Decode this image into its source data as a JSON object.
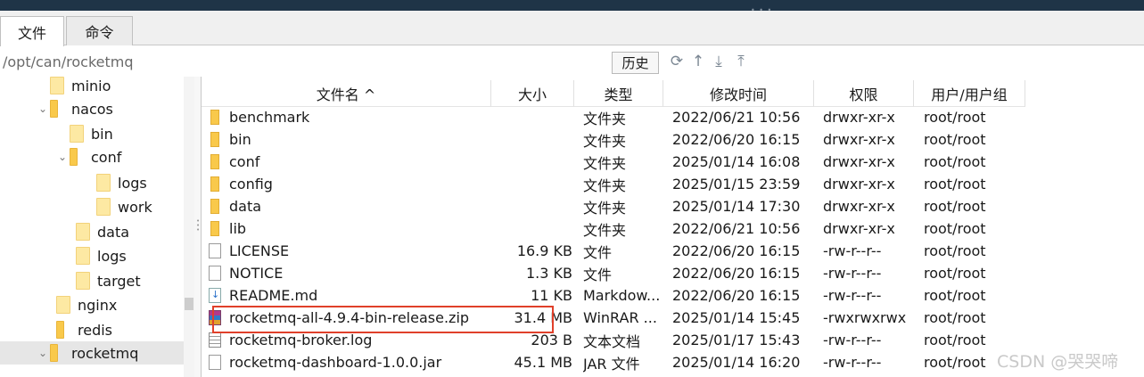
{
  "tabs": [
    {
      "label": "文件"
    },
    {
      "label": "命令"
    }
  ],
  "path": "/opt/can/rocketmq",
  "history_button": "历史",
  "toolbar_icons": [
    "refresh-icon",
    "upload-icon",
    "download-icon",
    "upload-tray-icon"
  ],
  "tree": [
    {
      "label": "minio",
      "expanded": null
    },
    {
      "label": "nacos",
      "expanded": true
    },
    {
      "label": "bin",
      "expanded": null
    },
    {
      "label": "conf",
      "expanded": true
    },
    {
      "label": "logs",
      "expanded": null
    },
    {
      "label": "work",
      "expanded": null
    },
    {
      "label": "data",
      "expanded": null
    },
    {
      "label": "logs",
      "expanded": null
    },
    {
      "label": "target",
      "expanded": null
    },
    {
      "label": "nginx",
      "expanded": null
    },
    {
      "label": "redis",
      "expanded": null
    },
    {
      "label": "rocketmq",
      "expanded": true,
      "selected": true
    }
  ],
  "columns": [
    "文件名 ^",
    "大小",
    "类型",
    "修改时间",
    "权限",
    "用户/用户组"
  ],
  "files": [
    {
      "name": "benchmark",
      "size": "",
      "type": "文件夹",
      "mtime": "2022/06/21 10:56",
      "perm": "drwxr-xr-x",
      "owner": "root/root",
      "icon": "folder-icon"
    },
    {
      "name": "bin",
      "size": "",
      "type": "文件夹",
      "mtime": "2022/06/20 16:15",
      "perm": "drwxr-xr-x",
      "owner": "root/root",
      "icon": "folder-icon"
    },
    {
      "name": "conf",
      "size": "",
      "type": "文件夹",
      "mtime": "2025/01/14 16:08",
      "perm": "drwxr-xr-x",
      "owner": "root/root",
      "icon": "folder-icon"
    },
    {
      "name": "config",
      "size": "",
      "type": "文件夹",
      "mtime": "2025/01/15 23:59",
      "perm": "drwxr-xr-x",
      "owner": "root/root",
      "icon": "folder-icon"
    },
    {
      "name": "data",
      "size": "",
      "type": "文件夹",
      "mtime": "2025/01/14 17:30",
      "perm": "drwxr-xr-x",
      "owner": "root/root",
      "icon": "folder-icon"
    },
    {
      "name": "lib",
      "size": "",
      "type": "文件夹",
      "mtime": "2022/06/21 10:56",
      "perm": "drwxr-xr-x",
      "owner": "root/root",
      "icon": "folder-icon"
    },
    {
      "name": "LICENSE",
      "size": "16.9 KB",
      "type": "文件",
      "mtime": "2022/06/20 16:15",
      "perm": "-rw-r--r--",
      "owner": "root/root",
      "icon": "file-icon"
    },
    {
      "name": "NOTICE",
      "size": "1.3 KB",
      "type": "文件",
      "mtime": "2022/06/20 16:15",
      "perm": "-rw-r--r--",
      "owner": "root/root",
      "icon": "file-icon"
    },
    {
      "name": "README.md",
      "size": "11 KB",
      "type": "Markdow...",
      "mtime": "2022/06/20 16:15",
      "perm": "-rw-r--r--",
      "owner": "root/root",
      "icon": "markdown-file-icon"
    },
    {
      "name": "rocketmq-all-4.9.4-bin-release.zip",
      "size": "31.4 MB",
      "type": "WinRAR ...",
      "mtime": "2025/01/14 15:45",
      "perm": "-rwxrwxrwx",
      "owner": "root/root",
      "icon": "winrar-archive-icon"
    },
    {
      "name": "rocketmq-broker.log",
      "size": "203 B",
      "type": "文本文档",
      "mtime": "2025/01/17 15:43",
      "perm": "-rw-r--r--",
      "owner": "root/root",
      "icon": "text-document-icon"
    },
    {
      "name": "rocketmq-dashboard-1.0.0.jar",
      "size": "45.1 MB",
      "type": "JAR 文件",
      "mtime": "2025/01/14 16:20",
      "perm": "-rw-r--r--",
      "owner": "root/root",
      "icon": "jar-file-icon"
    }
  ],
  "watermark": "CSDN @哭哭啼"
}
